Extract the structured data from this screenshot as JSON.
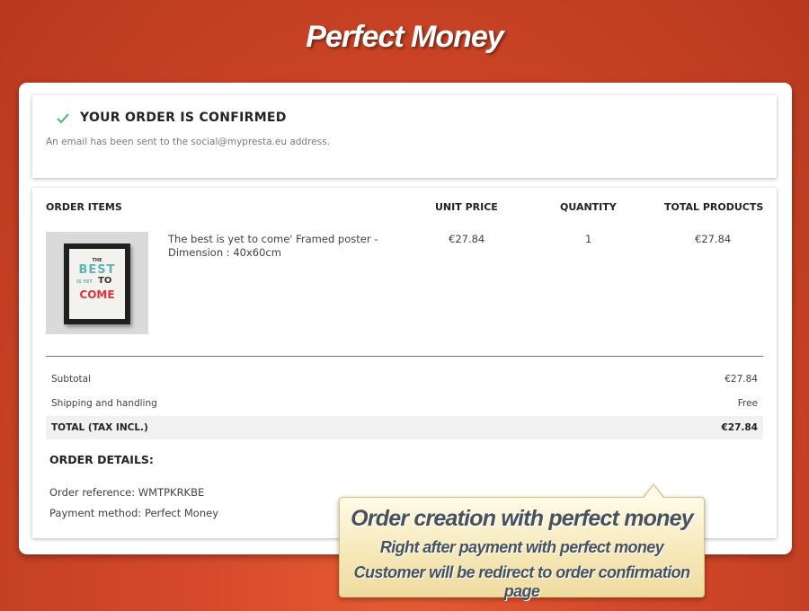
{
  "banner": {
    "title": "Perfect Money"
  },
  "confirmation": {
    "title": "YOUR ORDER IS CONFIRMED",
    "subtitle": "An email has been sent to the social@mypresta.eu address."
  },
  "order": {
    "columns": {
      "items": "ORDER ITEMS",
      "unit_price": "UNIT PRICE",
      "quantity": "QUANTITY",
      "total_products": "TOTAL PRODUCTS"
    },
    "line_items": [
      {
        "name": "The best is yet to come' Framed poster - Dimension : 40x60cm",
        "unit_price": "€27.84",
        "quantity": "1",
        "total": "€27.84",
        "thumbnail": {
          "line1": "THE",
          "line2": "BEST",
          "line3": "IS YET",
          "line4": "TO",
          "line5": "COME"
        }
      }
    ],
    "summary": {
      "subtotal_label": "Subtotal",
      "subtotal_value": "€27.84",
      "shipping_label": "Shipping and handling",
      "shipping_value": "Free",
      "total_label": "TOTAL (TAX INCL.)",
      "total_value": "€27.84"
    },
    "details": {
      "title": "ORDER DETAILS:",
      "reference": "Order reference: WMTPKRKBE",
      "payment": "Payment method: Perfect Money"
    }
  },
  "callout": {
    "heading": "Order creation with perfect money",
    "line1": "Right after payment with perfect money",
    "line2": "Customer will be redirect to order confirmation page"
  },
  "colors": {
    "background": "#d4482a",
    "check": "#4cbb6c",
    "poster_teal": "#5fb3b3",
    "poster_red": "#d9343a"
  }
}
